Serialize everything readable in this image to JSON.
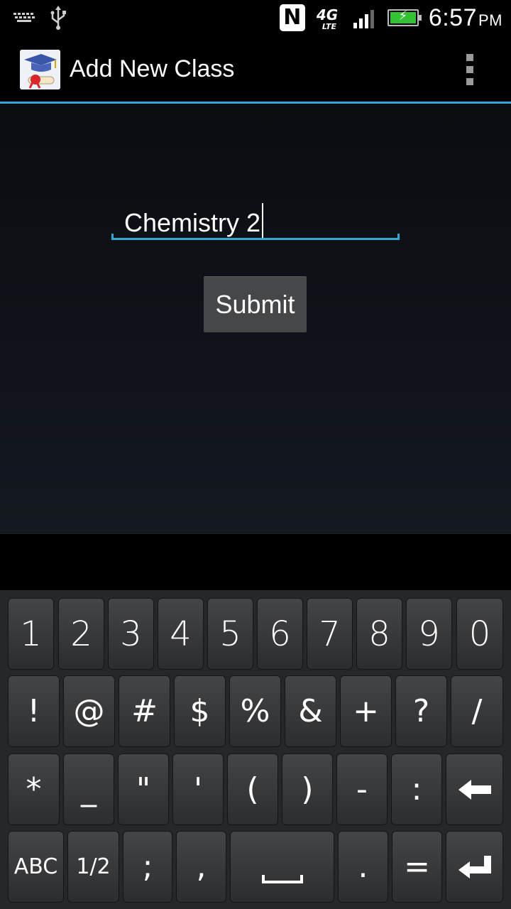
{
  "status_bar": {
    "time": "6:57",
    "ampm": "PM",
    "network": "4G",
    "network_sub": "LTE",
    "nfc": "N",
    "icons": [
      "keyboard-icon",
      "usb-icon",
      "nfc-icon",
      "lte-icon",
      "signal-icon",
      "battery-charging-icon"
    ]
  },
  "action_bar": {
    "title": "Add New Class",
    "app_icon": "graduation-cap-diploma-icon",
    "overflow_icon": "overflow-menu-icon"
  },
  "form": {
    "class_name_value": "Chemistry 2",
    "submit_label": "Submit"
  },
  "keyboard": {
    "row1": [
      "1",
      "2",
      "3",
      "4",
      "5",
      "6",
      "7",
      "8",
      "9",
      "0"
    ],
    "row2": [
      "!",
      "@",
      "#",
      "$",
      "%",
      "&",
      "+",
      "?",
      "/"
    ],
    "row3": [
      "*",
      "_",
      "\"",
      "'",
      "(",
      ")",
      "-",
      ":"
    ],
    "row4": [
      "ABC",
      "1/2",
      ";",
      ",",
      ".",
      "="
    ],
    "backspace_icon": "backspace-icon",
    "enter_icon": "enter-icon",
    "space_icon": "space-bar-icon"
  },
  "colors": {
    "accent": "#33a6d6",
    "button": "#464749",
    "battery": "#33c233"
  }
}
